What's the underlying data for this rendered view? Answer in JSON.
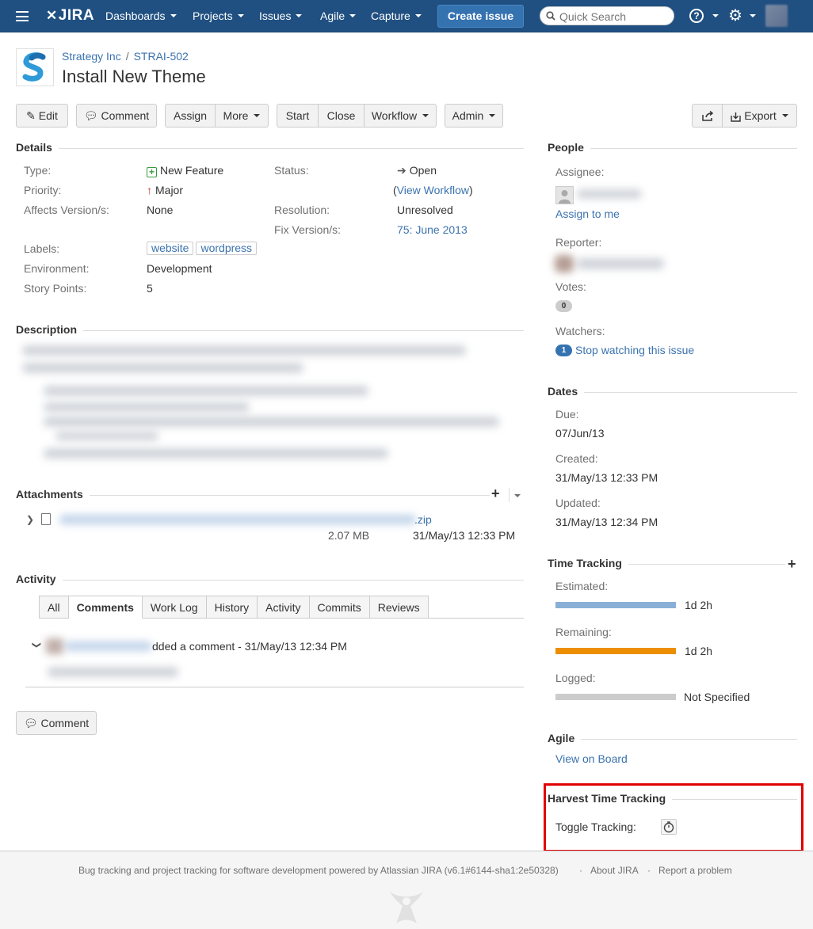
{
  "nav": {
    "logo": "JIRA",
    "menus": [
      {
        "label": "Dashboards"
      },
      {
        "label": "Projects"
      },
      {
        "label": "Issues"
      },
      {
        "label": "Agile"
      },
      {
        "label": "Capture"
      }
    ],
    "create_label": "Create issue",
    "search_placeholder": "Quick Search"
  },
  "breadcrumb": {
    "project": "Strategy Inc",
    "issue_key": "STRAI-502"
  },
  "issue": {
    "title": "Install New Theme"
  },
  "toolbar": {
    "edit": "Edit",
    "comment": "Comment",
    "assign": "Assign",
    "more": "More",
    "start": "Start",
    "close": "Close",
    "workflow": "Workflow",
    "admin": "Admin",
    "export": "Export"
  },
  "details": {
    "heading": "Details",
    "type_label": "Type:",
    "type_value": "New Feature",
    "priority_label": "Priority:",
    "priority_value": "Major",
    "affects_label": "Affects Version/s:",
    "affects_value": "None",
    "status_label": "Status:",
    "status_value": "Open",
    "view_workflow": "View Workflow",
    "resolution_label": "Resolution:",
    "resolution_value": "Unresolved",
    "fix_label": "Fix Version/s:",
    "fix_value": "75: June 2013",
    "labels_label": "Labels:",
    "labels": [
      "website",
      "wordpress"
    ],
    "environment_label": "Environment:",
    "environment_value": "Development",
    "story_points_label": "Story Points:",
    "story_points_value": "5"
  },
  "description": {
    "heading": "Description"
  },
  "attachments": {
    "heading": "Attachments",
    "file_ext": ".zip",
    "file_size": "2.07 MB",
    "file_date": "31/May/13 12:33 PM"
  },
  "activity": {
    "heading": "Activity",
    "tabs": [
      "All",
      "Comments",
      "Work Log",
      "History",
      "Activity",
      "Commits",
      "Reviews"
    ],
    "comment_action": "dded a comment - 31/May/13 12:34 PM",
    "comment_button": "Comment"
  },
  "people": {
    "heading": "People",
    "assignee_label": "Assignee:",
    "assign_to_me": "Assign to me",
    "reporter_label": "Reporter:",
    "votes_label": "Votes:",
    "votes_count": "0",
    "watchers_label": "Watchers:",
    "watchers_count": "1",
    "stop_watching": "Stop watching this issue"
  },
  "dates": {
    "heading": "Dates",
    "due_label": "Due:",
    "due_value": "07/Jun/13",
    "created_label": "Created:",
    "created_value": "31/May/13 12:33 PM",
    "updated_label": "Updated:",
    "updated_value": "31/May/13 12:34 PM"
  },
  "time_tracking": {
    "heading": "Time Tracking",
    "estimated_label": "Estimated:",
    "estimated_value": "1d 2h",
    "estimated_fraction": 1.0,
    "remaining_label": "Remaining:",
    "remaining_value": "1d 2h",
    "remaining_fraction": 1.0,
    "logged_label": "Logged:",
    "logged_value": "Not Specified",
    "logged_fraction": 0.0,
    "colors": {
      "estimated": "#89afd7",
      "remaining": "#ec8e00",
      "logged": "#cccccc"
    }
  },
  "agile": {
    "heading": "Agile",
    "view_on_board": "View on Board"
  },
  "harvest": {
    "heading": "Harvest Time Tracking",
    "toggle_label": "Toggle Tracking:"
  },
  "footer": {
    "powered_by": "Bug tracking and project tracking for software development powered by Atlassian JIRA (v6.1#6144-sha1:2e50328)",
    "about": "About JIRA",
    "report": "Report a problem"
  }
}
